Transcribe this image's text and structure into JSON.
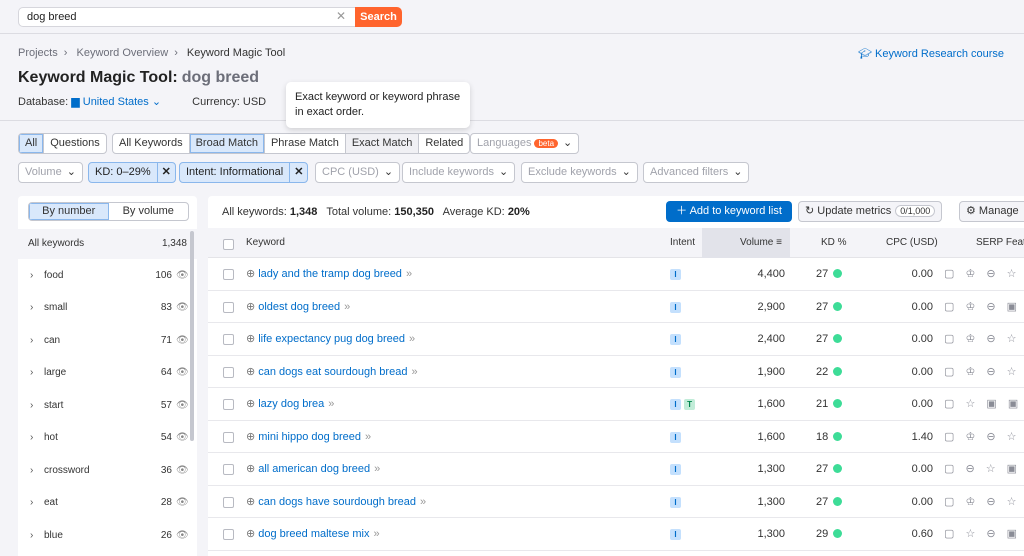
{
  "search": {
    "value": "dog breed",
    "button": "Search",
    "clear_icon": "close-icon"
  },
  "breadcrumb": [
    "Projects",
    "Keyword Overview",
    "Keyword Magic Tool"
  ],
  "course_link": "Keyword Research course",
  "title": {
    "prefix": "Keyword Magic Tool:",
    "query": "dog breed"
  },
  "database": {
    "label": "Database:",
    "value": "United States",
    "currency": "Currency: USD"
  },
  "tooltip": "Exact keyword or keyword phrase in exact order.",
  "tabs1": [
    {
      "label": "All",
      "active": true
    },
    {
      "label": "Questions",
      "active": false
    }
  ],
  "tabs2": [
    {
      "label": "All Keywords",
      "active": false
    },
    {
      "label": "Broad Match",
      "active": true
    },
    {
      "label": "Phrase Match",
      "active": false
    },
    {
      "label": "Exact Match",
      "active": false
    },
    {
      "label": "Related",
      "active": false
    }
  ],
  "languages": {
    "label": "Languages",
    "badge": "beta"
  },
  "filters": {
    "volume": "Volume",
    "kd": "KD: 0–29%",
    "intent": "Intent: Informational",
    "cpc": "CPC (USD)",
    "include": "Include keywords",
    "exclude": "Exclude keywords",
    "advanced": "Advanced filters"
  },
  "sidebar": {
    "tabs": [
      "By number",
      "By volume"
    ],
    "active_tab": 0,
    "all_label": "All keywords",
    "all_count": "1,348",
    "items": [
      {
        "label": "food",
        "count": "106"
      },
      {
        "label": "small",
        "count": "83"
      },
      {
        "label": "can",
        "count": "71"
      },
      {
        "label": "large",
        "count": "64"
      },
      {
        "label": "start",
        "count": "57"
      },
      {
        "label": "hot",
        "count": "54"
      },
      {
        "label": "crossword",
        "count": "36"
      },
      {
        "label": "eat",
        "count": "28"
      },
      {
        "label": "blue",
        "count": "26"
      }
    ]
  },
  "summary": {
    "all_label": "All keywords:",
    "all": "1,348",
    "vol_label": "Total volume:",
    "vol": "150,350",
    "kd_label": "Average KD:",
    "kd": "20%"
  },
  "actions": {
    "add": "Add to keyword list",
    "update": "Update metrics",
    "update_count": "0/1,000",
    "manage": "Manage"
  },
  "columns": [
    "Keyword",
    "Intent",
    "Volume",
    "KD %",
    "CPC (USD)",
    "SERP Features"
  ],
  "rows": [
    {
      "keyword": "lady and the tramp dog breed",
      "intent": [
        "I"
      ],
      "volume": "4,400",
      "kd": "27",
      "cpc": "0.00",
      "serp": "▢ ♔ ⊖ ☆ ▣"
    },
    {
      "keyword": "oldest dog breed",
      "intent": [
        "I"
      ],
      "volume": "2,900",
      "kd": "27",
      "cpc": "0.00",
      "serp": "▢ ♔ ⊖ ▣ ◐"
    },
    {
      "keyword": "life expectancy pug dog breed",
      "intent": [
        "I"
      ],
      "volume": "2,400",
      "kd": "27",
      "cpc": "0.00",
      "serp": "▢ ♔ ⊖ ☆ ◐"
    },
    {
      "keyword": "can dogs eat sourdough bread",
      "intent": [
        "I"
      ],
      "volume": "1,900",
      "kd": "22",
      "cpc": "0.00",
      "serp": "▢ ♔ ⊖ ☆ ◐"
    },
    {
      "keyword": "lazy dog brea",
      "intent": [
        "I",
        "T"
      ],
      "volume": "1,600",
      "kd": "21",
      "cpc": "0.00",
      "serp": "▢ ☆ ▣ ▣ ▣"
    },
    {
      "keyword": "mini hippo dog breed",
      "intent": [
        "I"
      ],
      "volume": "1,600",
      "kd": "18",
      "cpc": "1.40",
      "serp": "▢ ♔ ⊖ ☆ ▣"
    },
    {
      "keyword": "all american dog breed",
      "intent": [
        "I"
      ],
      "volume": "1,300",
      "kd": "27",
      "cpc": "0.00",
      "serp": "▢ ⊖ ☆ ▣ ▣"
    },
    {
      "keyword": "can dogs have sourdough bread",
      "intent": [
        "I"
      ],
      "volume": "1,300",
      "kd": "27",
      "cpc": "0.00",
      "serp": "▢ ♔ ⊖ ☆ ◐"
    },
    {
      "keyword": "dog breed maltese mix",
      "intent": [
        "I"
      ],
      "volume": "1,300",
      "kd": "29",
      "cpc": "0.60",
      "serp": "▢ ☆ ⊖ ▣ ▣"
    }
  ],
  "colors": {
    "accent": "#006dca",
    "search": "#ff642d",
    "kd_easy": "#3ddc97"
  }
}
